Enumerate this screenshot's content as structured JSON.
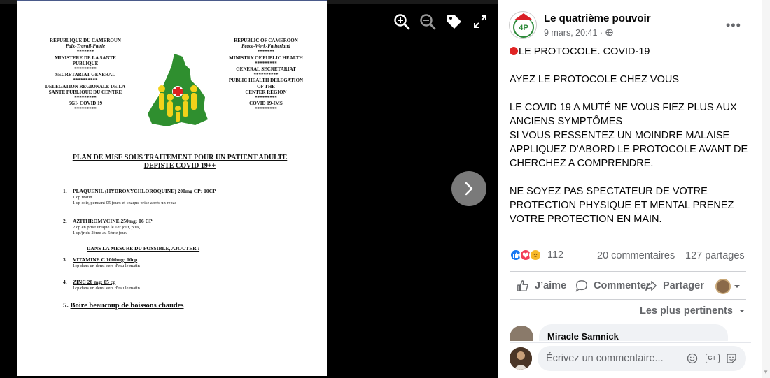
{
  "document": {
    "header_left": [
      "REPUBLIQUE DU CAMEROUN",
      "Paix-Travail-Patrie",
      "*******",
      "MINISTERE DE LA SANTE",
      "PUBLIQUE",
      "*********",
      "SECRETARIAT GENERAL",
      "**********",
      "DELEGATION REGIONALE DE LA",
      "SANTE PUBLIQUE DU CENTRE",
      "*********",
      "SGI- COVID 19",
      "*********"
    ],
    "header_right": [
      "REPUBLIC OF CAMEROON",
      "Peace-Work-Fatherland",
      "*******",
      "MINISTRY OF PUBLIC HEALTH",
      "*********",
      "GENERAL SECRETARIAT",
      "**********",
      "PUBLIC HEALTH DELEGATION",
      "OF THE",
      "CENTER REGION",
      "*********",
      "COVID 19-IMS",
      "*********"
    ],
    "title_line1": "PLAN DE MISE SOUS TRAITEMENT POUR UN PATIENT ADULTE",
    "title_line2": "DEPISTE COVID 19++",
    "items": [
      {
        "num": "1.",
        "name": "PLAQUENIL (HYDROXYCHLOROQUINE) 200mg CP: 10CP",
        "lines": [
          "1 cp matin",
          "1 cp soir, pendant 05 jours et chaque prise après un repas"
        ]
      },
      {
        "num": "2.",
        "name": "AZITHROMYCINE 250mg: 06 CP",
        "lines": [
          "2 cp en prise unique le 1er jour, puis,",
          "1 cp/jr du 2ème au 5ème jour."
        ]
      },
      {
        "num": "3.",
        "name": "VITAMINE C 1000mg: 10cp",
        "lines": [
          "1cp dans un demi vers d'eau le matin"
        ]
      },
      {
        "num": "4.",
        "name": "ZINC 20 mg: 05 cp",
        "lines": [
          "1cp dans un demi vers d'eau le matin"
        ]
      }
    ],
    "mesure": "DANS LA MESURE DU POSSIBLE, AJOUTER :",
    "item5_num": "5.",
    "item5_text": "Boire beaucoup de boissons chaudes"
  },
  "viewer_controls": [
    "zoom-in-icon",
    "zoom-out-icon",
    "tag-icon",
    "fullscreen-icon"
  ],
  "post": {
    "page_name": "Le quatrième pouvoir",
    "timestamp": "9 mars, 20:41 · ",
    "more": "•••",
    "text_line1": "LE PROTOCOLE. COVID-19",
    "text_line2": "AYEZ LE PROTOCOLE CHEZ VOUS",
    "text_line3": "LE COVID 19 A MUTÉ NE VOUS FIEZ PLUS AUX ANCIENS SYMPTÔMES",
    "text_line4": "SI VOUS RESSENTEZ UN MOINDRE MALAISE APPLIQUEZ D'ABORD LE PROTOCOLE AVANT DE CHERCHEZ A COMPRENDRE.",
    "text_line5": "NE SOYEZ PAS SPECTATEUR DE VOTRE PROTECTION PHYSIQUE ET MENTAL PRENEZ VOTRE PROTECTION EN MAIN.",
    "reactions_count": "112",
    "comments_count": "20 commentaires",
    "shares_count": "127 partages",
    "like_label": "J’aime",
    "comment_label": "Commenter",
    "share_label": "Partager",
    "sort_label": "Les plus pertinents",
    "preview_commenter": "Miracle Samnick",
    "comment_placeholder": "Écrivez un commentaire...",
    "gif_label": "GIF"
  },
  "colors": {
    "accent": "#1877f2",
    "love": "#f33e58",
    "care": "#f7b928",
    "muted": "#65676b",
    "red_dot": "#e02424"
  }
}
